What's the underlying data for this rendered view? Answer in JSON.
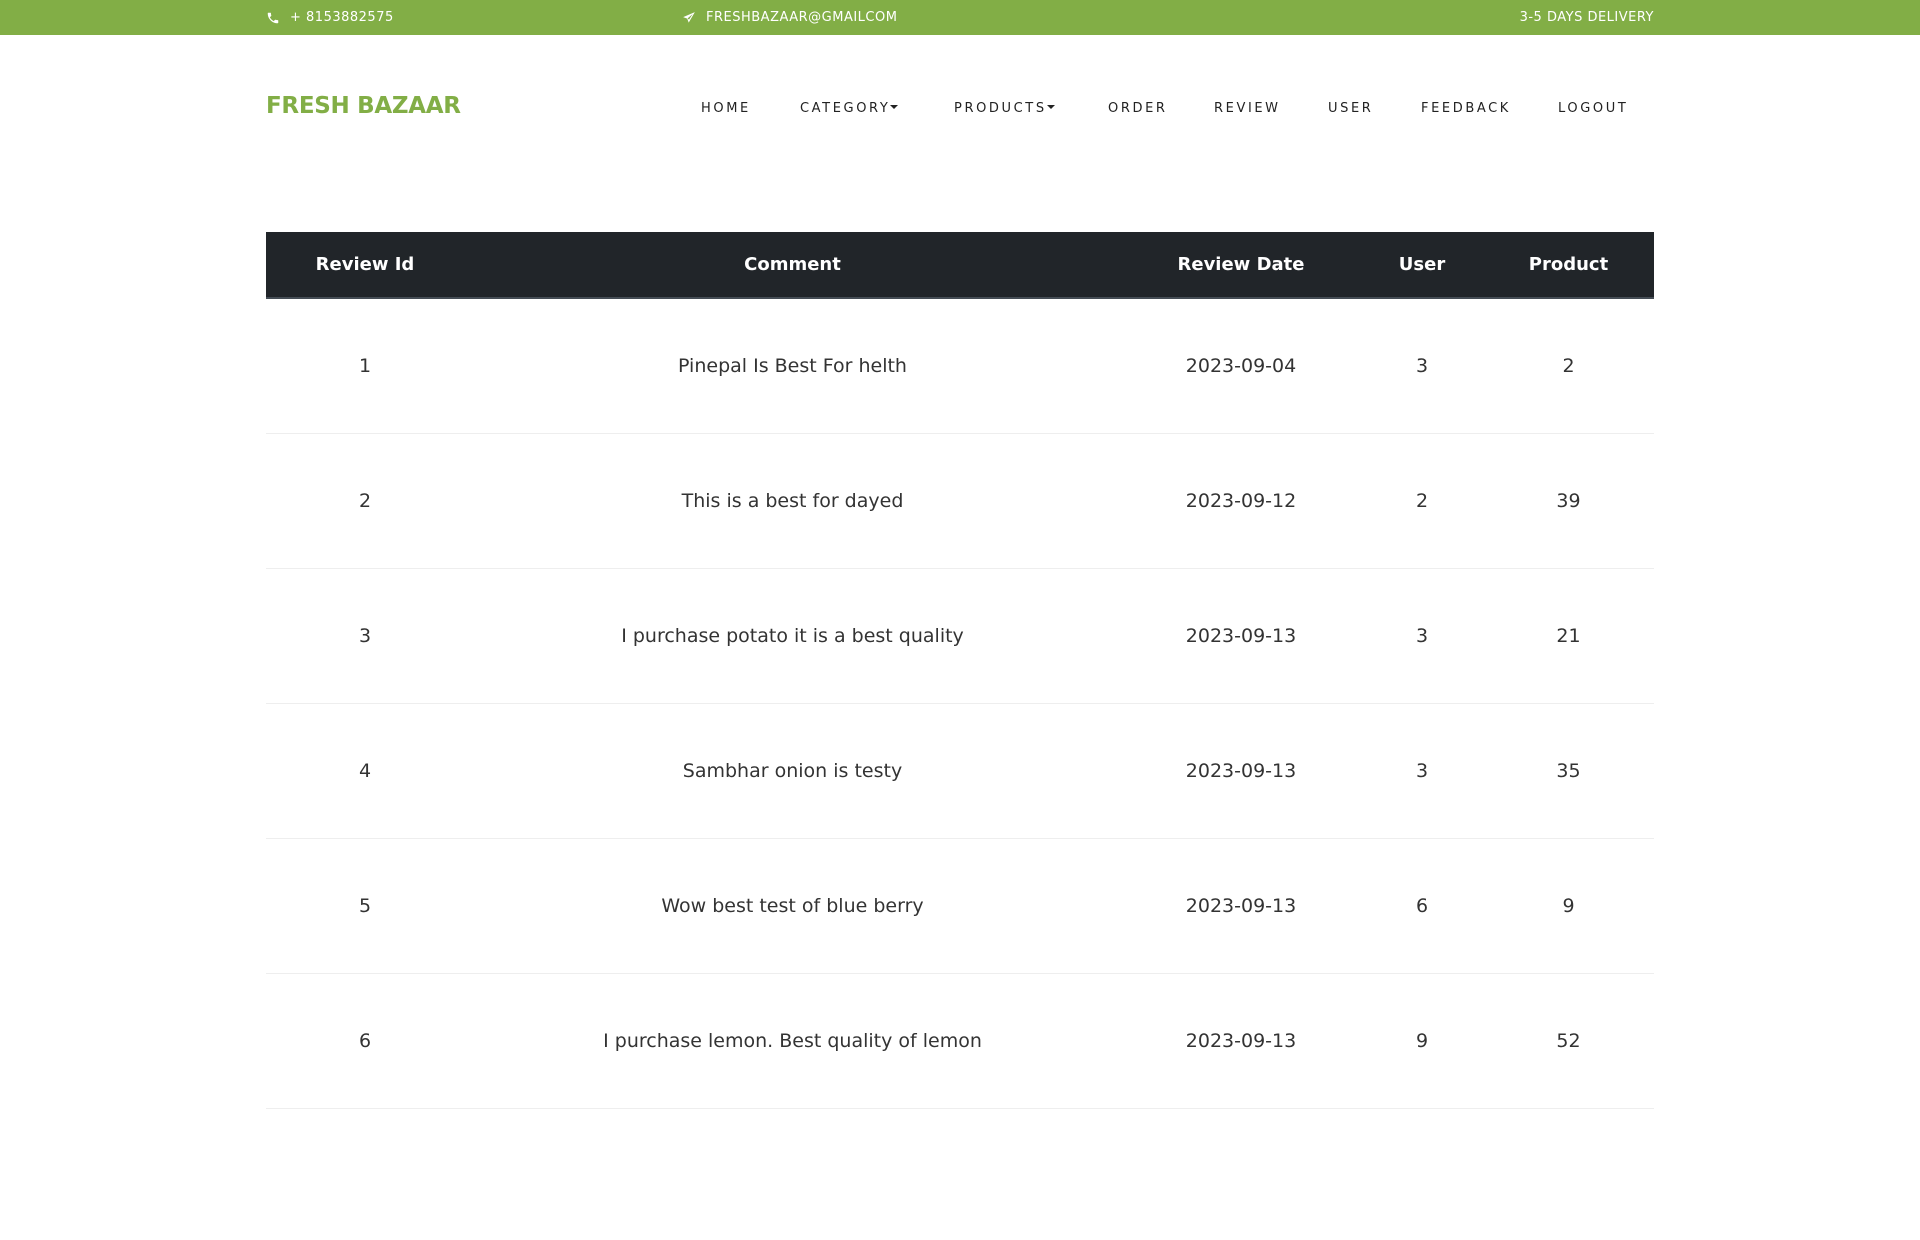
{
  "topbar": {
    "phone": "+ 8153882575",
    "email": "FRESHBAZAAR@GMAILCOM",
    "delivery": "3-5 DAYS DELIVERY",
    "bg_color": "#82ae46"
  },
  "brand": {
    "name": "FRESH BAZAAR",
    "color": "#82ae46"
  },
  "nav": {
    "home": "HOME",
    "category": "CATEGORY",
    "products": "PRODUCTS",
    "order": "ORDER",
    "review": "REVIEW",
    "user": "USER",
    "feedback": "FEEDBACK",
    "logout": "LOGOUT"
  },
  "table": {
    "header_bg": "#212529",
    "columns": {
      "id": "Review Id",
      "comment": "Comment",
      "date": "Review Date",
      "user": "User",
      "product": "Product"
    },
    "rows": [
      {
        "id": "1",
        "comment": "Pinepal Is Best For helth",
        "date": "2023-09-04",
        "user": "3",
        "product": "2"
      },
      {
        "id": "2",
        "comment": "This is a best for dayed",
        "date": "2023-09-12",
        "user": "2",
        "product": "39"
      },
      {
        "id": "3",
        "comment": "I purchase potato it is a best quality",
        "date": "2023-09-13",
        "user": "3",
        "product": "21"
      },
      {
        "id": "4",
        "comment": "Sambhar onion is testy",
        "date": "2023-09-13",
        "user": "3",
        "product": "35"
      },
      {
        "id": "5",
        "comment": "Wow best test of blue berry",
        "date": "2023-09-13",
        "user": "6",
        "product": "9"
      },
      {
        "id": "6",
        "comment": "I purchase lemon. Best quality of lemon",
        "date": "2023-09-13",
        "user": "9",
        "product": "52"
      }
    ]
  }
}
